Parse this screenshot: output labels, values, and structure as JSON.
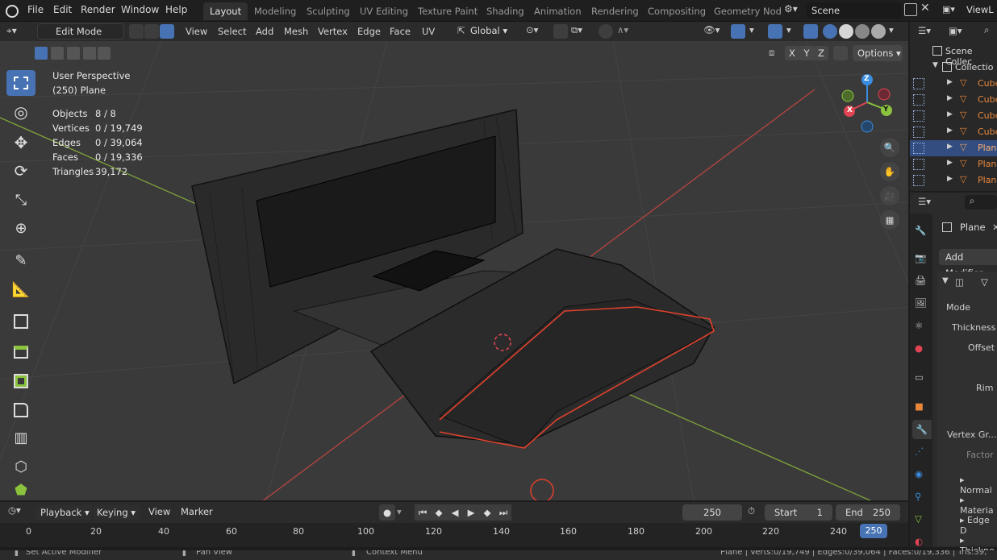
{
  "menubar": {
    "items": [
      "File",
      "Edit",
      "Render",
      "Window",
      "Help"
    ],
    "workspaces": [
      "Layout",
      "Modeling",
      "Sculpting",
      "UV Editing",
      "Texture Paint",
      "Shading",
      "Animation",
      "Rendering",
      "Compositing",
      "Geometry Nod"
    ],
    "scene": "Scene",
    "view_layer": "ViewL"
  },
  "header": {
    "mode": "Edit Mode",
    "menus": [
      "View",
      "Select",
      "Add",
      "Mesh",
      "Vertex",
      "Edge",
      "Face",
      "UV"
    ],
    "orientation": "Global",
    "options": "Options",
    "axes": [
      "X",
      "Y",
      "Z"
    ]
  },
  "viewport": {
    "perspective": "User Perspective",
    "object": "(250) Plane",
    "stats": [
      {
        "label": "Objects",
        "value": "8 / 8"
      },
      {
        "label": "Vertices",
        "value": "0 / 19,749"
      },
      {
        "label": "Edges",
        "value": "0 / 39,064"
      },
      {
        "label": "Faces",
        "value": "0 / 19,336"
      },
      {
        "label": "Triangles",
        "value": "39,172"
      }
    ],
    "gizmo": {
      "z": "Z",
      "y": "Y",
      "x": "X"
    }
  },
  "outliner": {
    "scene_collection": "Scene Collec",
    "collection": "Collectio",
    "items": [
      "Cube",
      "Cube",
      "Cube",
      "Cube",
      "Plane",
      "Plane",
      "Plane"
    ]
  },
  "properties": {
    "object": "Plane",
    "add_modifier": "Add Modifier",
    "fields": [
      "Mode",
      "Thickness",
      "Offset",
      "Rim",
      "Vertex Gr...",
      "Factor"
    ],
    "panels": [
      "Normal",
      "Materia",
      "Edge D",
      "Thickne"
    ]
  },
  "timeline": {
    "menus": [
      "Playback",
      "Keying",
      "View",
      "Marker"
    ],
    "current_frame": "250",
    "start_label": "Start",
    "start": "1",
    "end_label": "End",
    "end": "250",
    "ticks": [
      "0",
      "20",
      "40",
      "60",
      "80",
      "100",
      "120",
      "140",
      "160",
      "180",
      "200",
      "220",
      "240"
    ],
    "playhead": "250"
  },
  "statusbar": {
    "left": "Set Active Modifier",
    "middle": "Pan View",
    "context": "Context Menu",
    "right": "Plane | Verts:0/19,749 | Edges:0/39,064 | Faces:0/19,336 | Tris:39,"
  },
  "colors": {
    "accent": "#4772b3",
    "selection": "#334d80",
    "orange": "#e8863a",
    "x_axis": "#e04452",
    "y_axis": "#8bc33e",
    "z_axis": "#3a8de0"
  }
}
